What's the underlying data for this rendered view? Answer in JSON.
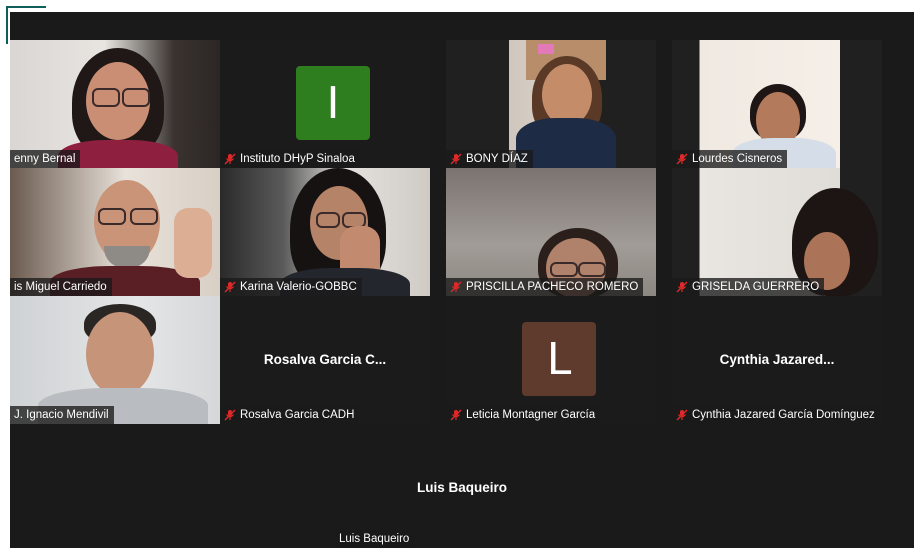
{
  "participants": [
    {
      "name": "enny Bernal",
      "muted": false
    },
    {
      "name": "Instituto DHyP Sinaloa",
      "muted": true,
      "initial": "I",
      "avatar_color": "#2e7d1f"
    },
    {
      "name": "BONY DÍAZ",
      "muted": true
    },
    {
      "name": "Lourdes Cisneros",
      "muted": true,
      "active_speaker": true
    },
    {
      "name": "is Miguel Carriedo",
      "muted": false
    },
    {
      "name": "Karina Valerio-GOBBC",
      "muted": true
    },
    {
      "name": "PRISCILLA PACHECO ROMERO",
      "muted": true
    },
    {
      "name": "GRISELDA GUERRERO",
      "muted": true
    },
    {
      "name": "J. Ignacio Mendivil",
      "muted": false
    },
    {
      "name": "Rosalva Garcia CADH",
      "muted": true,
      "display_name": "Rosalva Garcia C..."
    },
    {
      "name": "Leticia Montagner García",
      "muted": true,
      "initial": "L",
      "avatar_color": "#5e3b2c"
    },
    {
      "name": "Cynthia Jazared García Domínguez",
      "muted": true,
      "display_name": "Cynthia Jazared..."
    }
  ],
  "bottom_participant": {
    "name": "Luis Baqueiro",
    "display_name": "Luis Baqueiro"
  },
  "colors": {
    "stage": "#1a1a1a",
    "active_border": "#2ed16b",
    "mute": "#e02828"
  }
}
